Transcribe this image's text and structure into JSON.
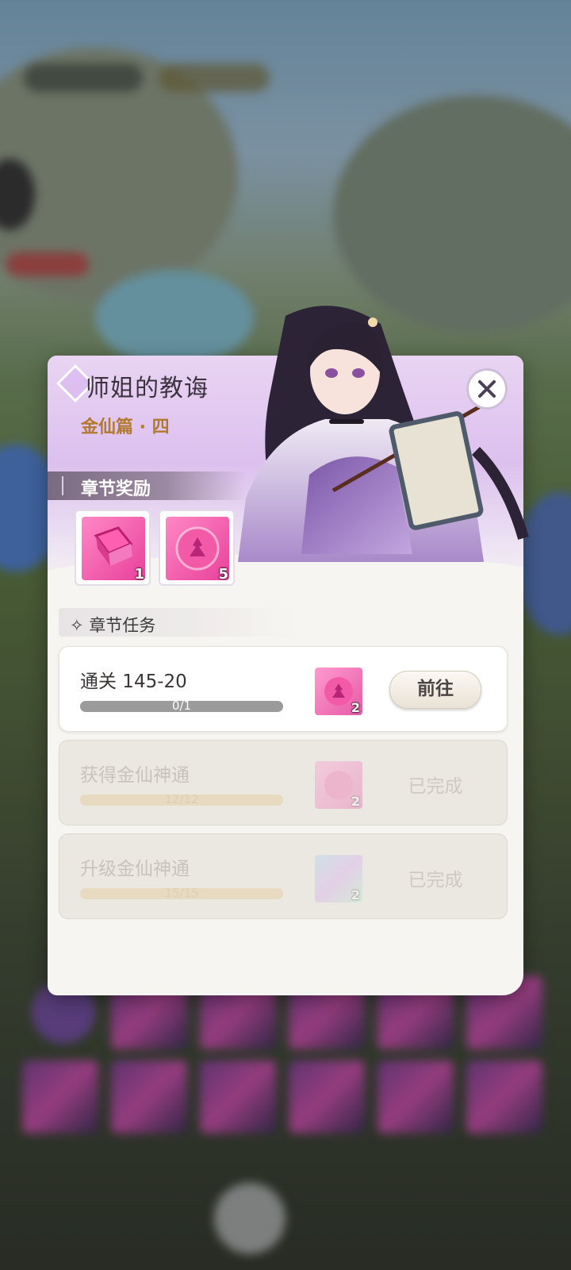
{
  "dialog": {
    "title": "师姐的教诲",
    "subtitle": "金仙篇 · 四",
    "rewards_section": {
      "label": "章节奖励",
      "items": [
        {
          "icon": "pink-book-icon",
          "count": "1"
        },
        {
          "icon": "pink-orb-icon",
          "count": "5"
        }
      ]
    },
    "tasks_section": {
      "label": "章节任务",
      "tasks": [
        {
          "name": "通关 145-20",
          "progress_text": "0/1",
          "progress": 0,
          "reward_icon": "pink-orb-icon",
          "reward_count": "2",
          "action": "前往",
          "status": "active"
        },
        {
          "name": "获得金仙神通",
          "progress_text": "12/12",
          "progress": 1,
          "reward_icon": "pink-orb-icon",
          "reward_count": "2",
          "action": "已完成",
          "status": "done"
        },
        {
          "name": "升级金仙神通",
          "progress_text": "15/15",
          "progress": 1,
          "reward_icon": "holo-orb-icon",
          "reward_count": "2",
          "action": "已完成",
          "status": "done"
        }
      ]
    }
  },
  "colors": {
    "accent_gold": "#b27a2e",
    "header_lilac": "#dcc0ee",
    "reward_pink": "#e8409a"
  }
}
